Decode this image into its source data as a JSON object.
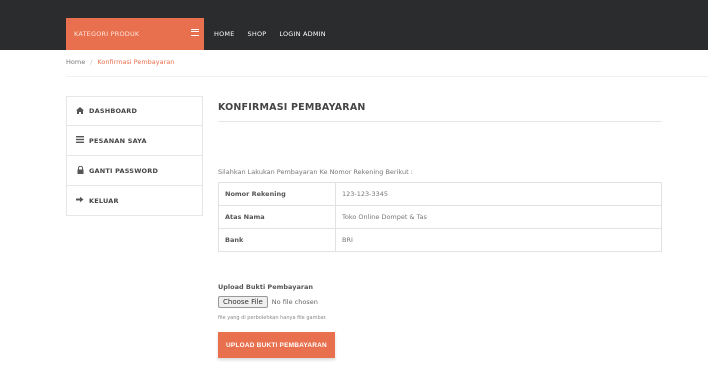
{
  "navbar": {
    "category_label": "KATEGORI PRODUK",
    "links": [
      "HOME",
      "SHOP",
      "LOGIN ADMIN"
    ]
  },
  "breadcrumb": {
    "home": "Home",
    "separator": "/",
    "current": "Konfirmasi Pembayaran"
  },
  "sidebar": {
    "items": [
      {
        "icon": "home-icon",
        "label": "DASHBOARD"
      },
      {
        "icon": "list-icon",
        "label": "PESANAN SAYA"
      },
      {
        "icon": "lock-icon",
        "label": "GANTI PASSWORD"
      },
      {
        "icon": "sign-out-icon",
        "label": "KELUAR"
      }
    ]
  },
  "main": {
    "title": "KONFIRMASI PEMBAYARAN",
    "instruction": "Silahkan Lakukan Pembayaran Ke Nomor Rekening Berikut :",
    "table": [
      {
        "key": "Nomor Rekening",
        "value": "123-123-3345"
      },
      {
        "key": "Atas Nama",
        "value": "Toko Online Dompet & Tas"
      },
      {
        "key": "Bank",
        "value": "BRI"
      }
    ],
    "upload_label": "Upload Bukti Pembayaran",
    "file_button": "Choose File",
    "file_status": "No file chosen",
    "file_hint": "file yang di perbolehkan hanya file gambar.",
    "submit_button": "UPLOAD BUKTI PEMBAYARAN"
  },
  "colors": {
    "accent": "#e9704e",
    "navbar_bg": "#2b2c2e"
  }
}
